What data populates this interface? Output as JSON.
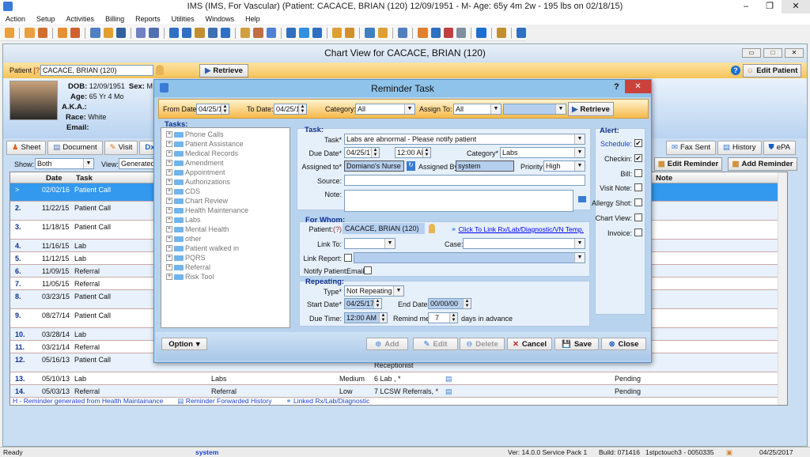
{
  "app": {
    "title": "IMS (IMS, For Vascular)    (Patient: CACACE, BRIAN  (120) 12/09/1951 - M- Age: 65y 4m 2w - 195 lbs on 02/18/15)",
    "menu": [
      "Action",
      "Setup",
      "Activities",
      "Billing",
      "Reports",
      "Utilities",
      "Windows",
      "Help"
    ]
  },
  "chart": {
    "title": "Chart View for CACACE, BRIAN  (120)",
    "patient_label": "Patient",
    "help_mark": "[?]",
    "patient_value": "CACACE, BRIAN  (120)",
    "retrieve": "Retrieve",
    "edit_patient": "Edit Patient",
    "dob_label": "DOB:",
    "dob": "12/09/1951",
    "sex_label": "Sex:",
    "sex": "M",
    "age_label": "Age:",
    "age": "65 Yr 4 Mo",
    "aka_label": "A.K.A.:",
    "race_label": "Race:",
    "race": "White",
    "email_label": "Email:",
    "tabs": [
      "Sheet",
      "Document",
      "Visit",
      "Dx"
    ],
    "tabs_right": [
      "Fax Sent",
      "History",
      "ePA"
    ],
    "show_label": "Show:",
    "show_value": "Both",
    "view_label": "View:",
    "view_value": "Generated",
    "edit_reminder": "Edit Reminder",
    "add_reminder": "Add Reminder",
    "columns": {
      "date": "Date",
      "task": "Task",
      "note": "Note"
    },
    "rows": [
      {
        "num": ">",
        "date": "02/02/16",
        "task": "Patient Call"
      },
      {
        "num": "2.",
        "date": "11/22/15",
        "task": "Patient Call"
      },
      {
        "num": "3.",
        "date": "11/18/15",
        "task": "Patient Call"
      },
      {
        "num": "4.",
        "date": "11/16/15",
        "task": "Lab"
      },
      {
        "num": "5.",
        "date": "11/12/15",
        "task": "Lab"
      },
      {
        "num": "6.",
        "date": "11/09/15",
        "task": "Referral"
      },
      {
        "num": "7.",
        "date": "11/05/15",
        "task": "Referral"
      },
      {
        "num": "8.",
        "date": "03/23/15",
        "task": "Patient Call"
      },
      {
        "num": "9.",
        "date": "08/27/14",
        "task": "Patient Call"
      },
      {
        "num": "10.",
        "date": "03/28/14",
        "task": "Lab"
      },
      {
        "num": "11.",
        "date": "03/21/14",
        "task": "Referral"
      },
      {
        "num": "12.",
        "date": "05/16/13",
        "task": "Patient Call",
        "assigned": "Receptionist"
      },
      {
        "num": "13.",
        "date": "05/10/13",
        "task": "Lab",
        "category": "Labs",
        "priority": "Medium",
        "assigned": "6 Lab , *",
        "status": "Pending"
      },
      {
        "num": "14.",
        "date": "05/03/13",
        "task": "Referral",
        "category": "Referral",
        "priority": "Low",
        "assigned": "7 LCSW Referrals, *",
        "status": "Pending"
      }
    ],
    "legend": [
      "H -  Reminder generated from Health Maintainance",
      "Reminder Forwarded History",
      "Linked Rx/Lab/Diagnostic"
    ]
  },
  "dialog": {
    "title": "Reminder Task",
    "help": "?",
    "from_label": "From Date:",
    "from": "04/25/17",
    "to_label": "To Date:",
    "to": "04/25/17",
    "category_label": "Category:",
    "category": "All",
    "assign_label": "Assign To:",
    "assign": "All",
    "retrieve": "Retrieve",
    "tasks_label": "Tasks:",
    "tree": [
      "Phone Calls",
      "Patient Assistance",
      "Medical Records",
      "Amendment",
      "Appointment",
      "Authorizations",
      "CDS",
      "Chart Review",
      "Health Maintenance",
      "Labs",
      "Mental Health",
      "other",
      "Patient walked in",
      "PQRS",
      "Referral",
      "Risk Tool"
    ],
    "task_group": "Task:",
    "task_label": "Task*",
    "task": "Labs are abnormal - Please notify patient",
    "due_label": "Due Date*",
    "due_date": "04/25/17",
    "due_time": "12:00 AM",
    "cat_label": "Category*",
    "cat": "Labs",
    "assigned_label": "Assigned to*",
    "assigned": "Domiano's Nurse",
    "by_label": "Assigned By:",
    "by": "system",
    "priority_label": "Priority:",
    "priority": "High",
    "source_label": "Source:",
    "note_label": "Note:",
    "alert_label": "Alert:",
    "alerts": [
      {
        "label": "Schedule:",
        "checked": true
      },
      {
        "label": "Checkin:",
        "checked": true
      },
      {
        "label": "Bill:",
        "checked": false
      },
      {
        "label": "Visit Note:",
        "checked": false
      },
      {
        "label": "Allergy Shot:",
        "checked": false
      },
      {
        "label": "Chart View:",
        "checked": false
      },
      {
        "label": "Invoice:",
        "checked": false
      }
    ],
    "for_whom": "For Whom:",
    "patient_label": "Patient:",
    "patient_help": "(?)",
    "patient": "CACACE, BRIAN  (120)",
    "link_text": "Click To Link Rx/Lab/Diagnostic/VN Temp.",
    "linkto_label": "Link To:",
    "case_label": "Case:",
    "linkreport_label": "Link Report:",
    "notify_label": "Notify Patient:",
    "email_label": "Email",
    "repeating": "Repeating:",
    "type_label": "Type*",
    "type": "Not Repeating",
    "start_label": "Start Date*",
    "start": "04/25/17",
    "end_label": "End Date:",
    "end": "00/00/00",
    "duetime_label": "Due Time:",
    "duetime": "12:00 AM",
    "remind_label": "Remind me:",
    "remind": "7",
    "advance": "days in advance",
    "option": "Option",
    "buttons": {
      "add": "Add",
      "edit": "Edit",
      "delete": "Delete",
      "cancel": "Cancel",
      "save": "Save",
      "close": "Close"
    }
  },
  "status": {
    "user": "system",
    "version": "Ver: 14.0.0 Service Pack 1",
    "build": "Build: 071416",
    "server": "1stpctouch3 - 0050335",
    "date": "04/25/2017",
    "ready": "Ready"
  }
}
